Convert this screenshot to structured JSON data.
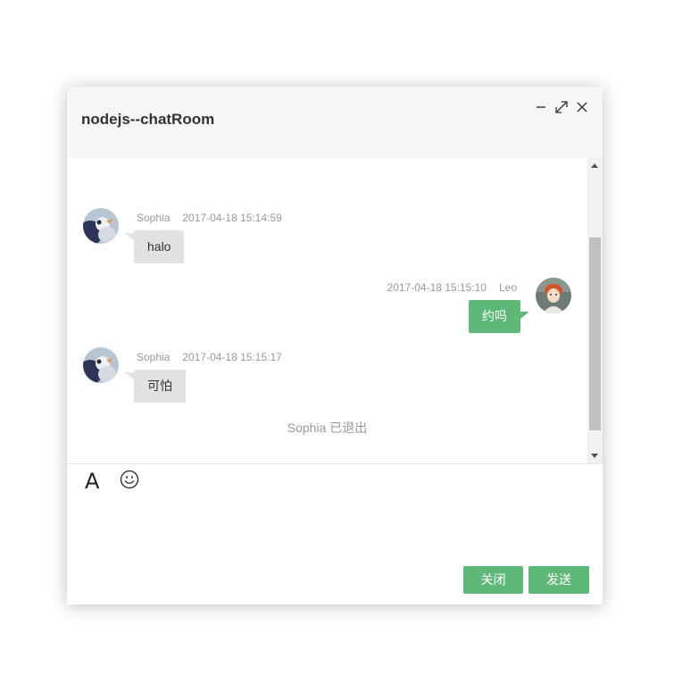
{
  "window": {
    "title": "nodejs--chatRoom",
    "controls": [
      "minimize-icon",
      "maximize-icon",
      "close-icon"
    ]
  },
  "messages": [
    {
      "side": "left",
      "user": "Sophia",
      "time": "2017-04-18 15:14:59",
      "text": "halo"
    },
    {
      "side": "right",
      "user": "Leo",
      "time": "2017-04-18 15:15:10",
      "text": "约吗"
    },
    {
      "side": "left",
      "user": "Sophia",
      "time": "2017-04-18 15:15:17",
      "text": "可怕"
    }
  ],
  "system_message": "Sophia 已退出",
  "toolbar": {
    "font_label": "A",
    "icons": [
      "font-icon",
      "emoji-icon"
    ]
  },
  "input": {
    "value": "",
    "placeholder": ""
  },
  "buttons": {
    "close_label": "关闭",
    "send_label": "发送"
  },
  "colors": {
    "accent": "#5fb878",
    "bubble_left": "#e2e2e2",
    "title_bar": "#f6f6f6"
  }
}
